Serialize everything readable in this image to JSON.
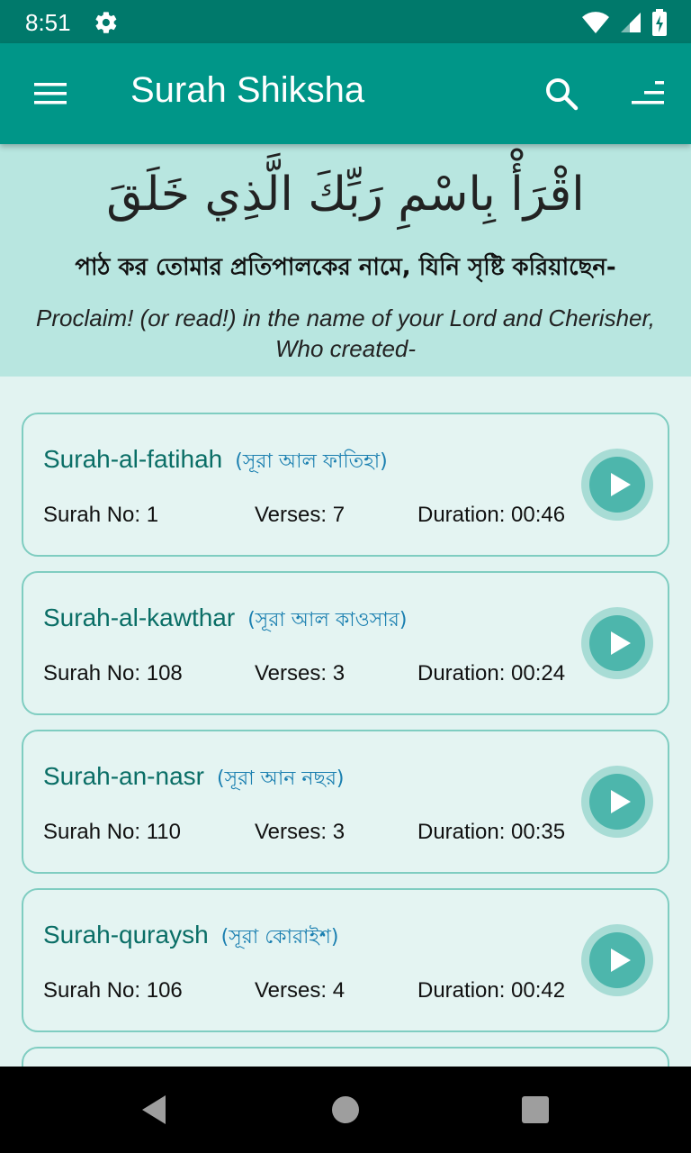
{
  "status_bar": {
    "time": "8:51",
    "icons": [
      "gear-icon",
      "wifi-icon",
      "signal-icon",
      "battery-charging-icon"
    ]
  },
  "app_bar": {
    "title": "Surah Shiksha",
    "icons": [
      "menu-icon",
      "search-icon",
      "sort-icon"
    ]
  },
  "banner": {
    "arabic": "اقْرَأْ بِاسْمِ رَبِّكَ الَّذِي خَلَقَ",
    "bangla": "পাঠ কর তোমার প্রতিপালকের নামে, যিনি সৃষ্টি করিয়াছেন-",
    "english": "Proclaim! (or read!) in the name of your Lord and Cherisher, Who created-"
  },
  "surahs": [
    {
      "name": "Surah-al-fatihah",
      "bangla": "(সূরা আল ফাতিহা)",
      "number": "Surah No: 1",
      "verses": "Verses: 7",
      "duration": "Duration: 00:46"
    },
    {
      "name": "Surah-al-kawthar",
      "bangla": "(সূরা আল কাওসার)",
      "number": "Surah No: 108",
      "verses": "Verses: 3",
      "duration": "Duration: 00:24"
    },
    {
      "name": "Surah-an-nasr",
      "bangla": "(সূরা আন নছর)",
      "number": "Surah No: 110",
      "verses": "Verses: 3",
      "duration": "Duration: 00:35"
    },
    {
      "name": "Surah-quraysh",
      "bangla": "(সূরা কোরাইশ)",
      "number": "Surah No: 106",
      "verses": "Verses: 4",
      "duration": "Duration: 00:42"
    }
  ],
  "colors": {
    "status_bar": "#00796b",
    "app_bar": "#009688",
    "banner": "#b8e6e0",
    "card_border": "#7fcdc1",
    "title_text": "#0a6e66",
    "bangla_text": "#1a7fb0",
    "play_button": "#4db6ac"
  }
}
